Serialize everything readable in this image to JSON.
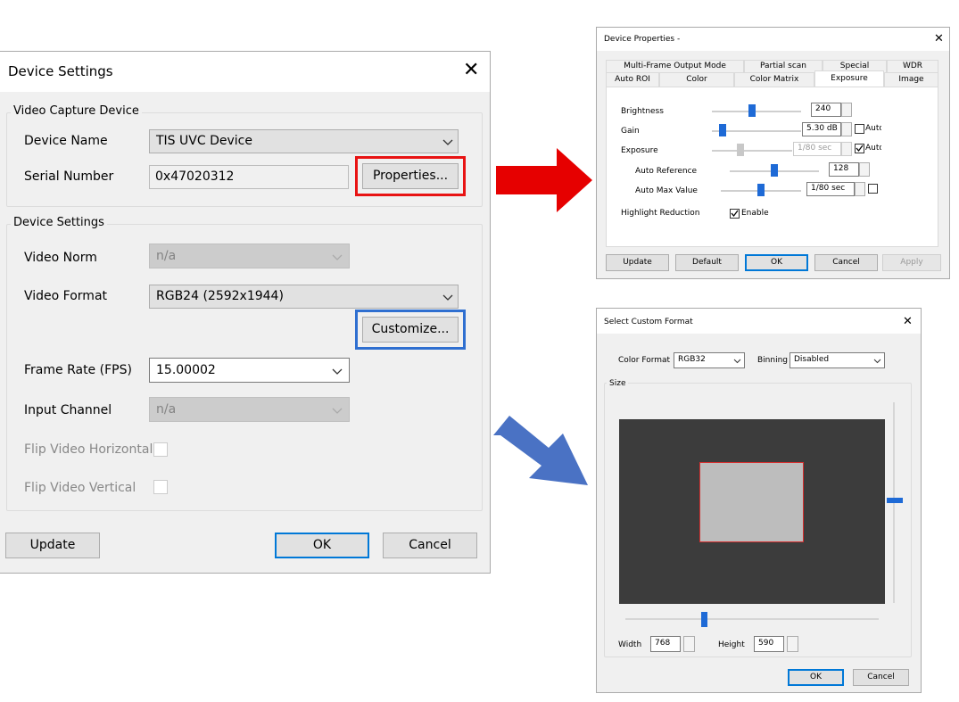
{
  "colors": {
    "red_highlight": "#e81313",
    "blue_highlight": "#2f6fd0",
    "red_arrow": "#e60000",
    "blue_arrow": "#4a72c4",
    "slider_thumb": "#1e6ad6",
    "preview_bg": "#3c3c3c",
    "roi_fill": "#bdbdbd",
    "roi_border": "#d32f2f"
  },
  "device_settings": {
    "title": "Device Settings",
    "close_glyph": "✕",
    "capture_group": {
      "label": "Video Capture Device",
      "device_name_label": "Device Name",
      "device_name_value": "TIS UVC Device",
      "serial_label": "Serial Number",
      "serial_value": "0x47020312",
      "properties_button": "Properties..."
    },
    "settings_group": {
      "label": "Device Settings",
      "video_norm_label": "Video Norm",
      "video_norm_value": "n/a",
      "video_format_label": "Video Format",
      "video_format_value": "RGB24 (2592x1944)",
      "customize_button": "Customize...",
      "frame_rate_label": "Frame Rate (FPS)",
      "frame_rate_value": "15.00002",
      "input_channel_label": "Input Channel",
      "input_channel_value": "n/a",
      "flip_h_label": "Flip Video Horizontal",
      "flip_v_label": "Flip Video Vertical"
    },
    "update_button": "Update",
    "ok_button": "OK",
    "cancel_button": "Cancel"
  },
  "device_properties": {
    "title": "Device Properties -",
    "close_glyph": "✕",
    "tabs_row1": [
      "Multi-Frame Output Mode",
      "Partial scan",
      "Special",
      "WDR"
    ],
    "tabs_row2": [
      "Auto ROI",
      "Color",
      "Color Matrix",
      "Exposure",
      "Image"
    ],
    "active_tab": "Exposure",
    "brightness_label": "Brightness",
    "brightness_value": "240",
    "brightness_level": 0.45,
    "gain_label": "Gain",
    "gain_value": "5.30 dB",
    "gain_level": 0.12,
    "gain_auto_label": "Auto",
    "exposure_label": "Exposure",
    "exposure_value": "1/80 sec",
    "exposure_level": 0.35,
    "exposure_auto_label": "Auto",
    "auto_reference_label": "Auto Reference",
    "auto_reference_value": "128",
    "auto_reference_level": 0.5,
    "auto_max_label": "Auto Max Value",
    "auto_max_value": "1/80 sec",
    "auto_max_level": 0.5,
    "highlight_label": "Highlight Reduction",
    "highlight_enable_label": "Enable",
    "update_button": "Update",
    "default_button": "Default",
    "ok_button": "OK",
    "cancel_button": "Cancel",
    "apply_button": "Apply"
  },
  "custom_format": {
    "title": "Select Custom Format",
    "close_glyph": "✕",
    "color_format_label": "Color Format",
    "color_format_value": "RGB32",
    "binning_label": "Binning",
    "binning_value": "Disabled",
    "size_label": "Size",
    "width_label": "Width",
    "width_value": "768",
    "height_label": "Height",
    "height_value": "590",
    "ok_button": "OK",
    "cancel_button": "Cancel"
  }
}
